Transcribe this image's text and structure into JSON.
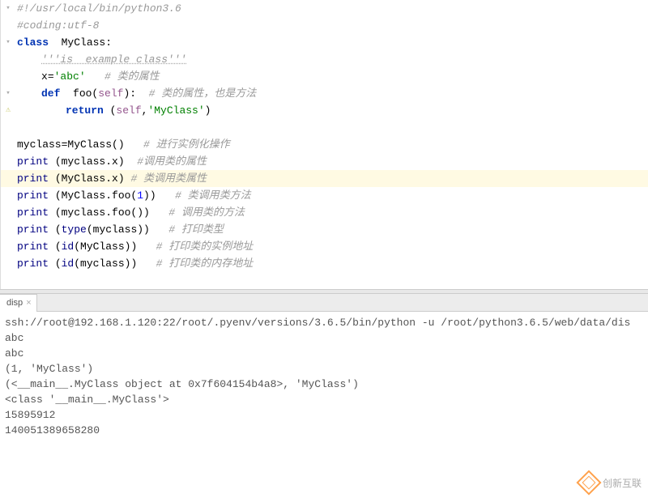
{
  "editor": {
    "lines": [
      {
        "gutter": "collapse",
        "indent": 0,
        "highlighted": false,
        "tokens": [
          {
            "t": "#!/usr/local/bin/python3.6",
            "c": "c-comment"
          }
        ]
      },
      {
        "gutter": "",
        "indent": 0,
        "highlighted": false,
        "tokens": [
          {
            "t": "#coding:utf-8",
            "c": "c-comment"
          }
        ]
      },
      {
        "gutter": "collapse",
        "indent": 0,
        "highlighted": false,
        "tokens": [
          {
            "t": "class",
            "c": "c-kw"
          },
          {
            "t": "  "
          },
          {
            "t": "MyClass",
            "c": "c-class"
          },
          {
            "t": ":"
          }
        ]
      },
      {
        "gutter": "",
        "indent": 1,
        "highlighted": false,
        "tokens": [
          {
            "t": "'''is  example class'''",
            "c": "c-comment docstring-underline"
          }
        ]
      },
      {
        "gutter": "",
        "indent": 1,
        "highlighted": false,
        "tokens": [
          {
            "t": "x"
          },
          {
            "t": "="
          },
          {
            "t": "'abc'",
            "c": "c-str"
          },
          {
            "t": "   "
          },
          {
            "t": "# 类的属性",
            "c": "c-comment"
          }
        ]
      },
      {
        "gutter": "collapse",
        "indent": 1,
        "highlighted": false,
        "tokens": [
          {
            "t": "def",
            "c": "c-def"
          },
          {
            "t": "  "
          },
          {
            "t": "foo",
            "c": "c-class"
          },
          {
            "t": "("
          },
          {
            "t": "self",
            "c": "c-self"
          },
          {
            "t": "):"
          },
          {
            "t": "  "
          },
          {
            "t": "# 类的属性，也是方法",
            "c": "c-comment"
          }
        ]
      },
      {
        "gutter": "warn",
        "indent": 2,
        "highlighted": false,
        "tokens": [
          {
            "t": "return",
            "c": "c-kw"
          },
          {
            "t": " ("
          },
          {
            "t": "self",
            "c": "c-self"
          },
          {
            "t": ","
          },
          {
            "t": "'MyClass'",
            "c": "c-str"
          },
          {
            "t": ")"
          }
        ]
      },
      {
        "gutter": "",
        "indent": 0,
        "highlighted": false,
        "tokens": []
      },
      {
        "gutter": "",
        "indent": 0,
        "highlighted": false,
        "tokens": [
          {
            "t": "myclass"
          },
          {
            "t": "="
          },
          {
            "t": "MyClass()"
          },
          {
            "t": "   "
          },
          {
            "t": "# 进行实例化操作",
            "c": "c-comment"
          }
        ]
      },
      {
        "gutter": "",
        "indent": 0,
        "highlighted": false,
        "tokens": [
          {
            "t": "print",
            "c": "c-builtin"
          },
          {
            "t": " (myclass.x)"
          },
          {
            "t": "  "
          },
          {
            "t": "#调用类的属性",
            "c": "c-comment"
          }
        ]
      },
      {
        "gutter": "",
        "indent": 0,
        "highlighted": true,
        "tokens": [
          {
            "t": "print",
            "c": "c-builtin"
          },
          {
            "t": " (MyClass.x)"
          },
          {
            "t": " "
          },
          {
            "t": "# 类调用类属性",
            "c": "c-comment"
          }
        ]
      },
      {
        "gutter": "",
        "indent": 0,
        "highlighted": false,
        "tokens": [
          {
            "t": "print",
            "c": "c-builtin"
          },
          {
            "t": " (MyClass.foo("
          },
          {
            "t": "1",
            "c": "c-num"
          },
          {
            "t": "))"
          },
          {
            "t": "   "
          },
          {
            "t": "# 类调用类方法",
            "c": "c-comment"
          }
        ]
      },
      {
        "gutter": "",
        "indent": 0,
        "highlighted": false,
        "tokens": [
          {
            "t": "print",
            "c": "c-builtin"
          },
          {
            "t": " (myclass.foo())"
          },
          {
            "t": "   "
          },
          {
            "t": "# 调用类的方法",
            "c": "c-comment"
          }
        ]
      },
      {
        "gutter": "",
        "indent": 0,
        "highlighted": false,
        "tokens": [
          {
            "t": "print",
            "c": "c-builtin"
          },
          {
            "t": " ("
          },
          {
            "t": "type",
            "c": "c-builtin"
          },
          {
            "t": "(myclass))"
          },
          {
            "t": "   "
          },
          {
            "t": "# 打印类型",
            "c": "c-comment"
          }
        ]
      },
      {
        "gutter": "",
        "indent": 0,
        "highlighted": false,
        "tokens": [
          {
            "t": "print",
            "c": "c-builtin"
          },
          {
            "t": " ("
          },
          {
            "t": "id",
            "c": "c-builtin"
          },
          {
            "t": "(MyClass))"
          },
          {
            "t": "   "
          },
          {
            "t": "# 打印类的实例地址",
            "c": "c-comment"
          }
        ]
      },
      {
        "gutter": "",
        "indent": 0,
        "highlighted": false,
        "tokens": [
          {
            "t": "print",
            "c": "c-builtin"
          },
          {
            "t": " ("
          },
          {
            "t": "id",
            "c": "c-builtin"
          },
          {
            "t": "(myclass))"
          },
          {
            "t": "   "
          },
          {
            "t": "# 打印类的内存地址",
            "c": "c-comment"
          }
        ]
      },
      {
        "gutter": "",
        "indent": 0,
        "highlighted": false,
        "tokens": []
      }
    ]
  },
  "tab": {
    "label": "disp",
    "close": "×"
  },
  "console": {
    "lines": [
      "ssh://root@192.168.1.120:22/root/.pyenv/versions/3.6.5/bin/python -u /root/python3.6.5/web/data/dis",
      "abc",
      "abc",
      "(1, 'MyClass')",
      "(<__main__.MyClass object at 0x7f604154b4a8>, 'MyClass')",
      "<class '__main__.MyClass'>",
      "15895912",
      "140051389658280"
    ]
  },
  "watermark": "创新互联"
}
